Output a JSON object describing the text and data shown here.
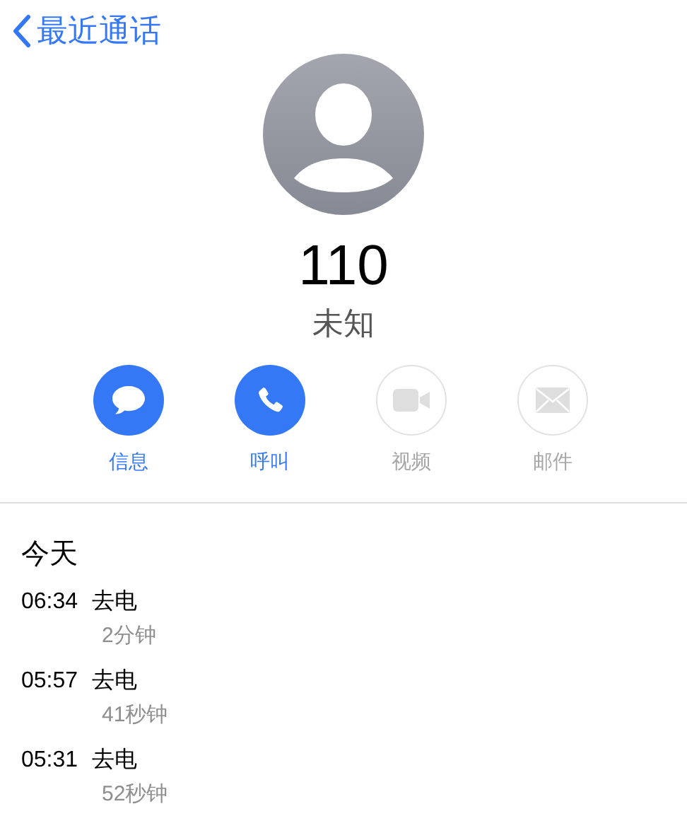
{
  "nav": {
    "back_label": "最近通话"
  },
  "contact": {
    "number": "110",
    "label": "未知"
  },
  "actions": [
    {
      "kind": "message",
      "label": "信息",
      "disabled": false
    },
    {
      "kind": "call",
      "label": "呼叫",
      "disabled": false
    },
    {
      "kind": "video",
      "label": "视频",
      "disabled": true
    },
    {
      "kind": "mail",
      "label": "邮件",
      "disabled": true
    }
  ],
  "history": {
    "heading": "今天",
    "calls": [
      {
        "time": "06:34",
        "type": "去电",
        "duration": "2分钟"
      },
      {
        "time": "05:57",
        "type": "去电",
        "duration": "41秒钟"
      },
      {
        "time": "05:31",
        "type": "去电",
        "duration": "52秒钟"
      }
    ]
  }
}
